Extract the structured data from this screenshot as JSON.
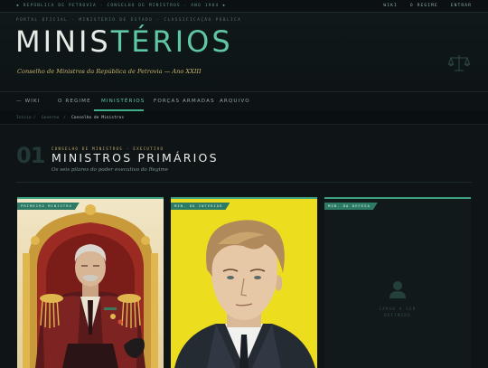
{
  "topbar": {
    "left_text": "◆ REPÚBLICA DE PETROVIA · CONSELHO DE MINISTROS · ANO 1984 ◆",
    "links": [
      "WIKI",
      "O REGIME",
      "ENTRAR"
    ]
  },
  "header": {
    "eyebrow": "PORTAL OFICIAL · MINISTÉRIO DE ESTADO · CLASSIFICAÇÃO PÚBLICA",
    "title_part1": "MINIS",
    "title_part2": "TÉRIOS",
    "subtitle": "Conselho de Ministros da República de Petrovia — Ano XXIII"
  },
  "nav": {
    "items": [
      "— WIKI",
      "O REGIME",
      "MINISTÉRIOS",
      "FORÇAS ARMADAS",
      "ARQUIVO"
    ],
    "active": "MINISTÉRIOS"
  },
  "breadcrumb": {
    "items": [
      "Início",
      "Governo",
      "Conselho de Ministros"
    ],
    "separator": "/"
  },
  "section": {
    "number": "01",
    "kicker": "CONSELHO DE MINISTROS · EXECUTIVO",
    "title": "MINISTROS PRIMÁRIOS",
    "subtitle": "Os seis pilares do poder executivo do Regime"
  },
  "cards": [
    {
      "tag": "PRIMEIRO MINISTRO"
    },
    {
      "tag": "MIN. DO INTERIOR"
    },
    {
      "tag": "MIN. DA DEFESA",
      "placeholder_text": [
        "CARGO A SER",
        "DEFINIDO"
      ]
    }
  ],
  "colors": {
    "accent": "#5fc7a4",
    "gold": "#c9b46c",
    "background": "#0f1517"
  }
}
